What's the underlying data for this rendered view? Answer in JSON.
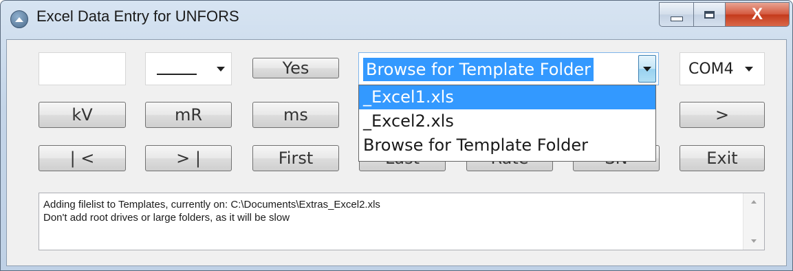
{
  "window": {
    "title": "Excel Data Entry for UNFORS",
    "close_label": "X"
  },
  "row1": {
    "text_input_value": "",
    "combo_blank_value": "___",
    "yes_label": "Yes",
    "template_combo_value": "Browse for Template Folder",
    "template_options": [
      "_Excel1.xls",
      "_Excel2.xls",
      "Browse for Template Folder"
    ],
    "port_value": "COM4"
  },
  "row2": {
    "kv_label": "kV",
    "mr_label": "mR",
    "ms_label": "ms",
    "next_label": ">"
  },
  "row3": {
    "first_nav_label": "| <",
    "last_nav_label": "> |",
    "first_label": "First",
    "last_label": "Last",
    "rate_label": "Rate",
    "sn_label": "SN",
    "exit_label": "Exit"
  },
  "log": {
    "line1": "Adding filelist to Templates, currently on: C:\\Documents\\Extras_Excel2.xls",
    "line2": "Don't add root drives or large folders, as it will be slow"
  },
  "icons": {
    "app": "app-icon",
    "minimize": "minimize-icon",
    "maximize": "maximize-icon",
    "close": "close-icon",
    "dropdown": "chevron-down-icon"
  },
  "colors": {
    "selection": "#3399ff",
    "close_button": "#c43a1b",
    "client_background": "#f0f0f0"
  }
}
